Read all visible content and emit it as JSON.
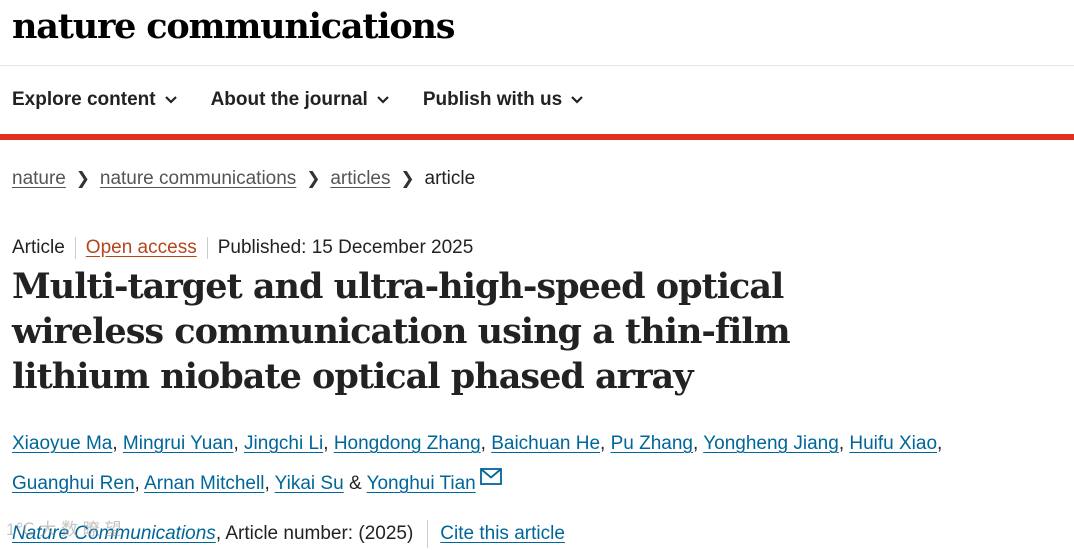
{
  "site": {
    "logo_text": "nature communications"
  },
  "nav": {
    "items": [
      {
        "label": "Explore content"
      },
      {
        "label": "About the journal"
      },
      {
        "label": "Publish with us"
      }
    ]
  },
  "colors": {
    "accent_red": "#e0301e",
    "link_blue": "#006699",
    "open_access_orange": "#b5451b"
  },
  "breadcrumb": {
    "items": [
      {
        "label": "nature"
      },
      {
        "label": "nature communications"
      },
      {
        "label": "articles"
      }
    ],
    "current": "article"
  },
  "article": {
    "type": "Article",
    "access": "Open access",
    "published": "Published: 15 December 2025",
    "title": "Multi-target and ultra-high-speed optical wireless communication using a thin-film lithium niobate optical phased array",
    "authors": [
      "Xiaoyue Ma",
      "Mingrui Yuan",
      "Jingchi Li",
      "Hongdong Zhang",
      "Baichuan He",
      "Pu Zhang",
      "Yongheng Jiang",
      "Huifu Xiao",
      "Guanghui Ren",
      "Arnan Mitchell",
      "Yikai Su",
      "Yonghui Tian"
    ],
    "author_separator": ", ",
    "author_last_joiner": " & ",
    "contact_icon": "envelope-icon"
  },
  "citation": {
    "journal": "Nature Communications",
    "article_number_text": ", Article number:  (2025)",
    "cite_label": "Cite this article"
  },
  "watermark": {
    "text": "1℃ 大 数 瞭 望"
  }
}
